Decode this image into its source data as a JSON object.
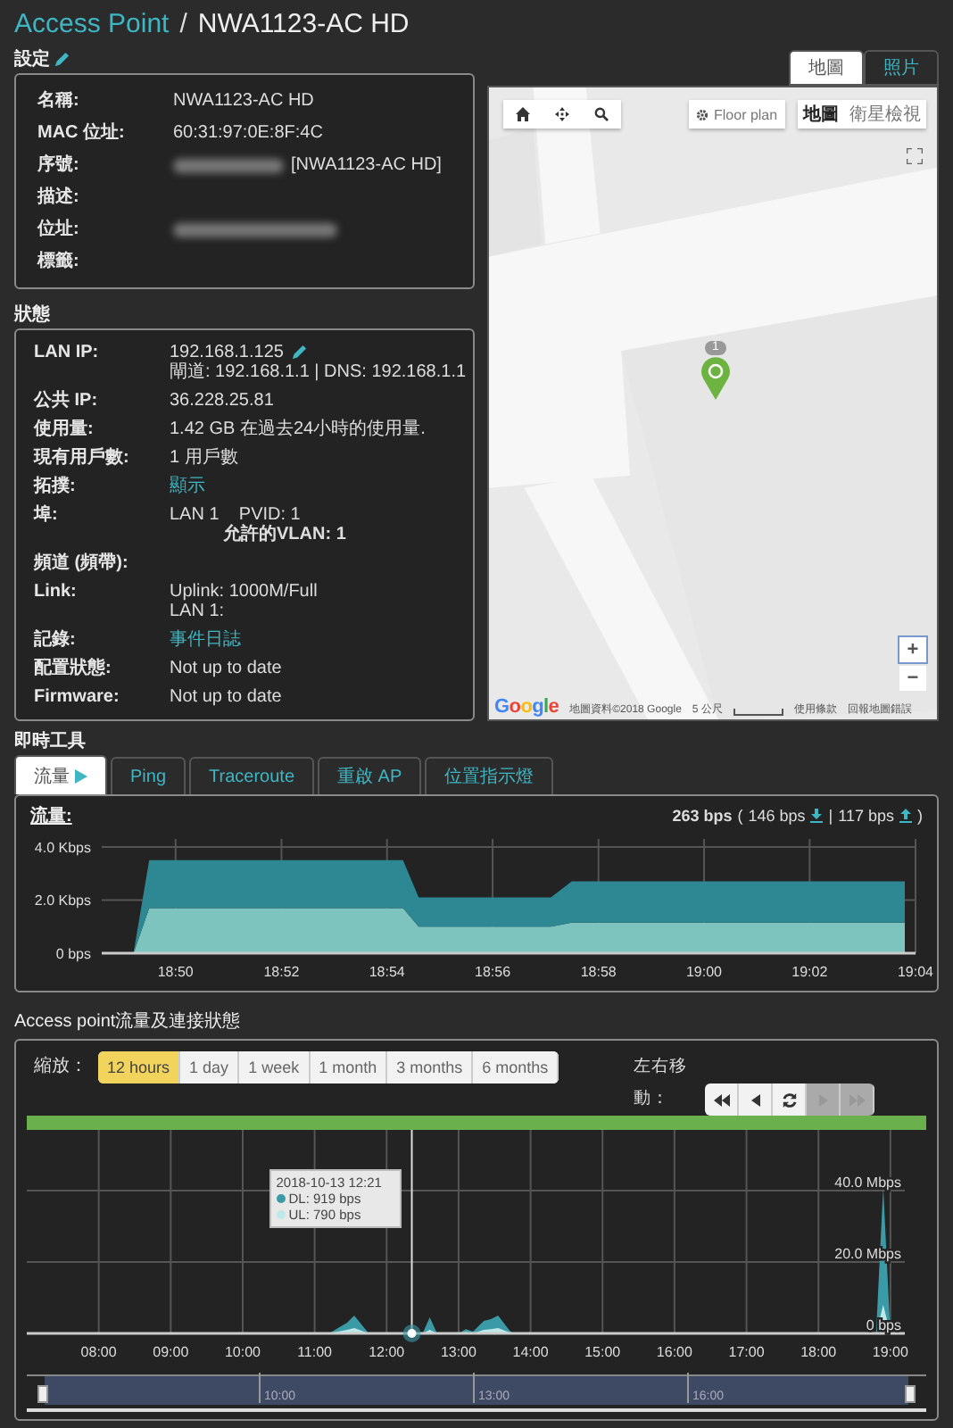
{
  "header": {
    "breadcrumb": "Access Point",
    "separator": "/",
    "title": "NWA1123-AC HD"
  },
  "settings": {
    "title": "設定",
    "editable": true,
    "rows": [
      {
        "label": "名稱:",
        "value": "NWA1123-AC HD",
        "redacted": false
      },
      {
        "label": "MAC 位址:",
        "value": "60:31:97:0E:8F:4C",
        "redacted": false
      },
      {
        "label": "序號:",
        "value": "[NWA1123-AC HD]",
        "redacted": true
      },
      {
        "label": "描述:",
        "redacted": false
      },
      {
        "label": "位址:",
        "redacted": true
      },
      {
        "label": "標籤:",
        "redacted": false
      }
    ]
  },
  "status": {
    "title": "狀態",
    "rows": [
      {
        "label": "LAN IP:",
        "editable": true,
        "lines": [
          {
            "text": "192.168.1.125",
            "kind": "plain"
          },
          {
            "text": "閘道: 192.168.1.1 | DNS: 192.168.1.1",
            "kind": "plain"
          }
        ]
      },
      {
        "label": "公共 IP:",
        "editable": false,
        "lines": [
          {
            "text": "36.228.25.81",
            "kind": "plain"
          }
        ]
      },
      {
        "label": "使用量:",
        "editable": false,
        "lines": [
          {
            "text": "1.42 GB 在過去24小時的使用量.",
            "kind": "plain"
          }
        ]
      },
      {
        "label": "現有用戶數:",
        "editable": false,
        "lines": [
          {
            "text": "1 用戶數",
            "kind": "plain"
          }
        ]
      },
      {
        "label": "拓撲:",
        "editable": false,
        "lines": [
          {
            "text": "顯示",
            "kind": "link"
          }
        ]
      },
      {
        "label": "埠:",
        "editable": false,
        "lines": [
          {
            "text": "LAN 1    PVID: 1",
            "kind": "plain"
          },
          {
            "text": "允許的VLAN: 1",
            "kind": "strong"
          }
        ]
      },
      {
        "label": "頻道 (頻帶):",
        "editable": false,
        "lines": []
      },
      {
        "label": "Link:",
        "editable": false,
        "lines": [
          {
            "text": "Uplink: 1000M/Full",
            "kind": "plain"
          },
          {
            "text": "LAN 1:",
            "kind": "plain"
          }
        ]
      },
      {
        "label": "記錄:",
        "editable": false,
        "lines": [
          {
            "text": "事件日誌",
            "kind": "link"
          }
        ]
      },
      {
        "label": "配置狀態:",
        "editable": false,
        "lines": [
          {
            "text": "Not up to date",
            "kind": "plain"
          }
        ]
      },
      {
        "label": "Firmware:",
        "editable": false,
        "lines": [
          {
            "text": "Not up to date",
            "kind": "plain"
          }
        ]
      }
    ]
  },
  "map": {
    "tabs": [
      {
        "label": "地圖",
        "selected": true
      },
      {
        "label": "照片",
        "selected": false
      }
    ],
    "floor_plan": "Floor plan",
    "view_toggle": [
      {
        "label": "地圖",
        "selected": true
      },
      {
        "label": "衛星檢視",
        "selected": false
      }
    ],
    "marker": {
      "count": "1"
    },
    "zoom_in": "+",
    "zoom_out": "−",
    "logo": "Google",
    "attribution": {
      "data": "地圖資料©2018 Google",
      "scale": "5 公尺",
      "terms": "使用條款",
      "report": "回報地圖錯誤"
    }
  },
  "tools": {
    "title": "即時工具",
    "tabs": [
      {
        "label": "流量",
        "selected": true,
        "kind": "play"
      },
      {
        "label": "Ping",
        "selected": false,
        "kind": "plain"
      },
      {
        "label": "Traceroute",
        "selected": false,
        "kind": "plain"
      },
      {
        "label": "重啟 AP",
        "selected": false,
        "kind": "plain"
      },
      {
        "label": "位置指示燈",
        "selected": false,
        "kind": "plain"
      }
    ],
    "traffic": {
      "label": "流量:",
      "summary": [
        {
          "text": "263 bps",
          "kind": "total"
        },
        {
          "text": "(",
          "kind": "plain"
        },
        {
          "text": "146 bps",
          "kind": "down"
        },
        {
          "text": "|",
          "kind": "plain"
        },
        {
          "text": "117 bps",
          "kind": "up"
        },
        {
          "text": ")",
          "kind": "plain"
        }
      ],
      "chart_data": {
        "type": "area",
        "stacked": true,
        "grid": true,
        "x": [
          18.8117,
          18.82,
          18.825,
          18.905,
          18.91,
          18.9517,
          18.9583,
          19.0633
        ],
        "xlim": [
          18.81,
          19.0667
        ],
        "ylim": [
          0,
          4.3
        ],
        "series": [
          {
            "color": "#7ec4be",
            "values": [
              0,
              0,
              1.7,
              1.7,
              1.0,
              1.0,
              1.15,
              1.15
            ]
          },
          {
            "color": "#2e8894",
            "values": [
              0,
              0,
              1.8,
              1.8,
              1.1,
              1.1,
              1.55,
              1.55
            ]
          }
        ],
        "yticks": [
          {
            "value": 0,
            "label": "0 bps"
          },
          {
            "value": 2,
            "label": "2.0 Kbps"
          },
          {
            "value": 4,
            "label": "4.0 Kbps"
          }
        ],
        "xticks": [
          {
            "value": 18.8333,
            "label": "18:50"
          },
          {
            "value": 18.8667,
            "label": "18:52"
          },
          {
            "value": 18.9,
            "label": "18:54"
          },
          {
            "value": 18.9333,
            "label": "18:56"
          },
          {
            "value": 18.9667,
            "label": "18:58"
          },
          {
            "value": 19.0,
            "label": "19:00"
          },
          {
            "value": 19.0333,
            "label": "19:02"
          },
          {
            "value": 19.0667,
            "label": "19:04"
          }
        ]
      }
    }
  },
  "history": {
    "title": "Access point流量及連接狀態",
    "zoom_label": "縮放：",
    "ranges": [
      {
        "label": "12 hours",
        "selected": true
      },
      {
        "label": "1 day",
        "selected": false
      },
      {
        "label": "1 week",
        "selected": false
      },
      {
        "label": "1 month",
        "selected": false
      },
      {
        "label": "3 months",
        "selected": false
      },
      {
        "label": "6 months",
        "selected": false
      }
    ],
    "pan_label": "左右移動：",
    "pan_buttons": [
      {
        "kind": "first",
        "disabled": false
      },
      {
        "kind": "prev",
        "disabled": false
      },
      {
        "kind": "refresh",
        "disabled": false
      },
      {
        "kind": "next",
        "disabled": true
      },
      {
        "kind": "last",
        "disabled": true
      }
    ],
    "chart_data": {
      "type": "area",
      "stacked": false,
      "grid": true,
      "x": [
        7,
        11.2,
        11.45,
        11.55,
        11.75,
        12.5,
        12.6,
        12.7,
        13.0,
        13.1,
        13.2,
        13.35,
        13.45,
        13.55,
        13.7,
        13.75,
        18.8,
        18.9,
        19.0
      ],
      "xlim": [
        7,
        19.2
      ],
      "ylim": [
        0,
        57
      ],
      "series": [
        {
          "color": "#3a9aa6",
          "values": [
            0,
            0,
            3,
            5,
            0,
            0,
            4.5,
            0,
            0,
            1.2,
            0.5,
            3.5,
            4,
            5,
            1,
            0,
            0,
            41,
            0
          ]
        },
        {
          "color": "#bfe8e8",
          "values": [
            0,
            0,
            1,
            1.5,
            0,
            0,
            1,
            0,
            0,
            0.4,
            0,
            1,
            1.2,
            1.5,
            0.3,
            0,
            0,
            8,
            0
          ]
        }
      ],
      "yticks": [
        {
          "value": 0,
          "label": "0 bps"
        },
        {
          "value": 20,
          "label": "20.0 Mbps"
        },
        {
          "value": 40,
          "label": "40.0 Mbps"
        }
      ],
      "xticks": [
        {
          "value": 8,
          "label": "08:00"
        },
        {
          "value": 9,
          "label": "09:00"
        },
        {
          "value": 10,
          "label": "10:00"
        },
        {
          "value": 11,
          "label": "11:00"
        },
        {
          "value": 12,
          "label": "12:00"
        },
        {
          "value": 13,
          "label": "13:00"
        },
        {
          "value": 14,
          "label": "14:00"
        },
        {
          "value": 15,
          "label": "15:00"
        },
        {
          "value": 16,
          "label": "16:00"
        },
        {
          "value": 17,
          "label": "17:00"
        },
        {
          "value": 18,
          "label": "18:00"
        },
        {
          "value": 19,
          "label": "19:00"
        }
      ],
      "ref_lines": [
        {
          "axis": "x",
          "value": 12.35
        }
      ]
    },
    "tooltip": {
      "title": "2018-10-13 12:21",
      "items": [
        {
          "text": "DL: 919 bps",
          "color": "#3a9aa6"
        },
        {
          "text": "UL: 790 bps",
          "color": "#bfe8e8"
        }
      ]
    },
    "navigator": {
      "labels": [
        "10:00",
        "13:00",
        "16:00"
      ]
    }
  }
}
